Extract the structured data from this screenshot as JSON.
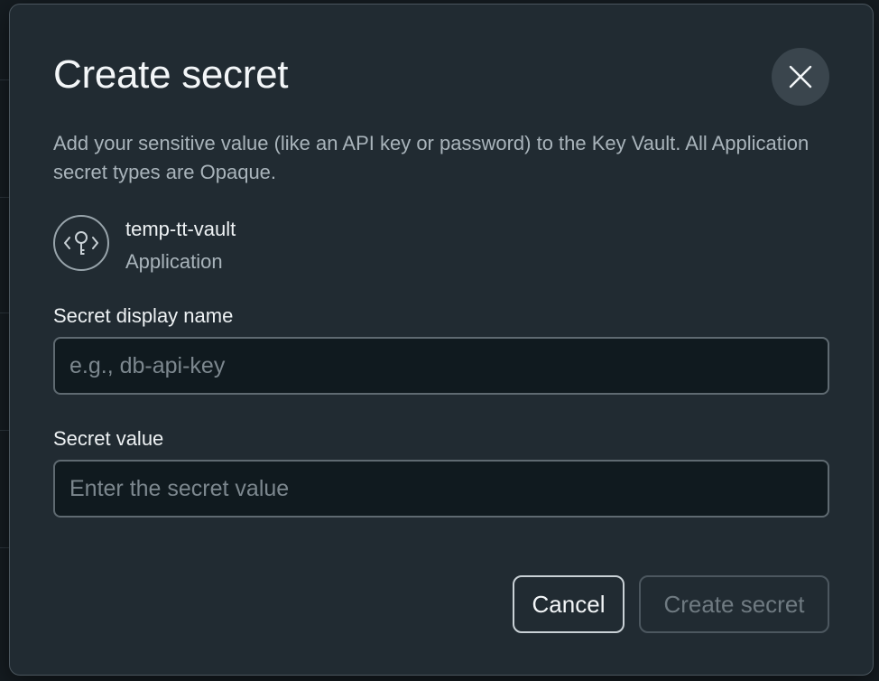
{
  "dialog": {
    "title": "Create secret",
    "close_label": "Close",
    "description": "Add your sensitive value (like an API key or password) to the Key Vault. All Application secret types are Opaque."
  },
  "vault": {
    "name": "temp-tt-vault",
    "type": "Application",
    "icon": "key-vault-icon"
  },
  "fields": {
    "display_name": {
      "label": "Secret display name",
      "placeholder": "e.g., db-api-key",
      "value": ""
    },
    "secret_value": {
      "label": "Secret value",
      "placeholder": "Enter the secret value",
      "value": ""
    }
  },
  "actions": {
    "cancel_label": "Cancel",
    "create_label": "Create secret"
  },
  "colors": {
    "dialog_bg": "#212b32",
    "input_bg": "#101a1f",
    "text_primary": "#f3f6f8",
    "text_secondary": "#a9b4bb",
    "disabled": "#6f7a81"
  }
}
